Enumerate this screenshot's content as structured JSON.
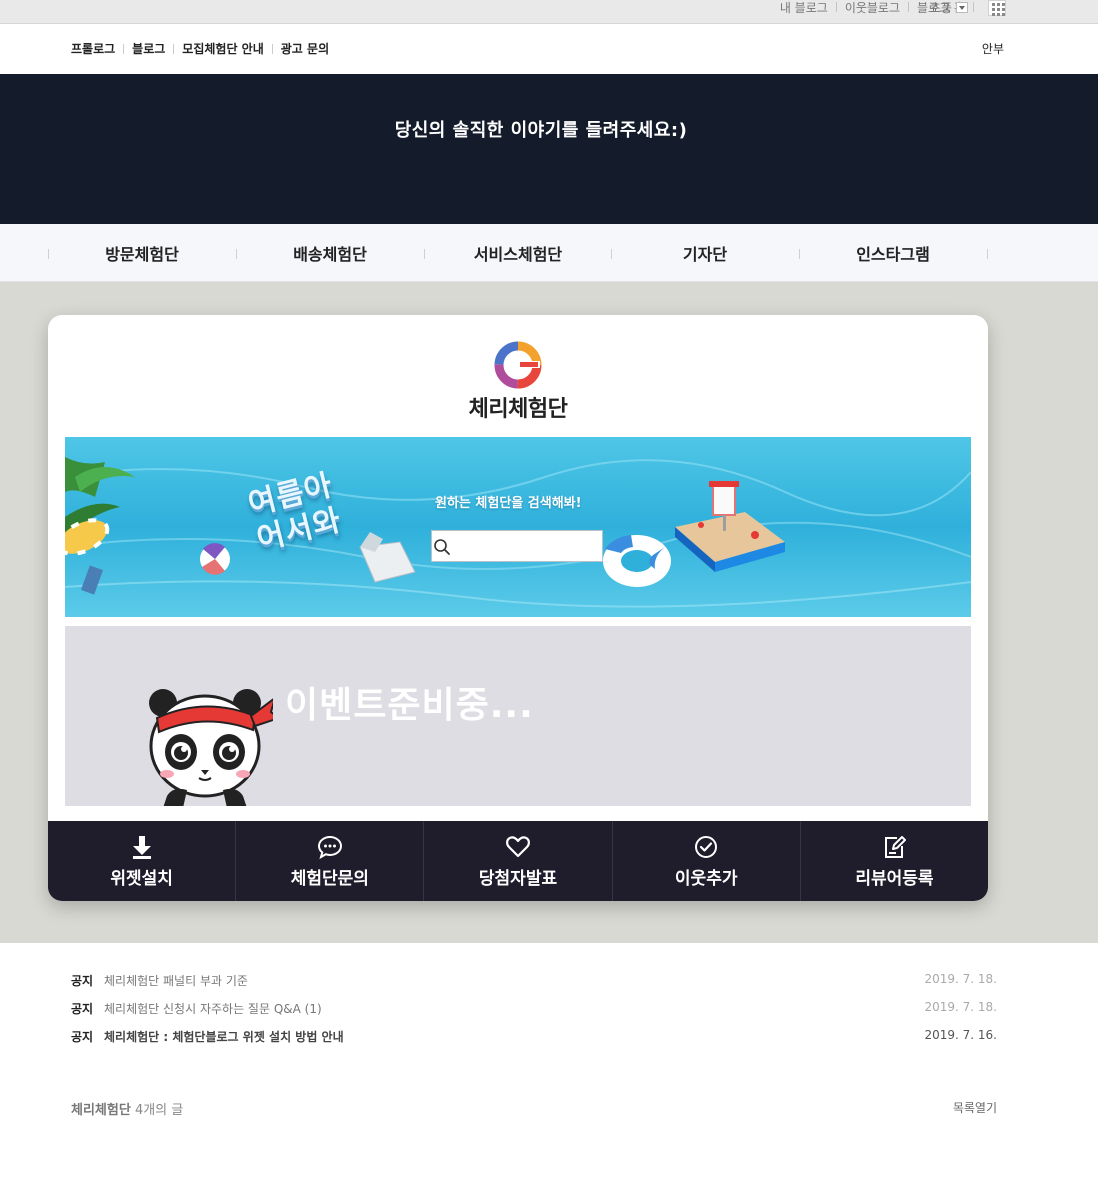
{
  "gnb": {
    "links": [
      "내 블로그",
      "이웃블로그",
      "블로그 홈"
    ],
    "font_label": "초풍"
  },
  "blog_menu": {
    "left_items": [
      "프롤로그",
      "블로그",
      "모집체험단 안내",
      "광고 문의"
    ],
    "right_item": "안부"
  },
  "header": {
    "title": "당신의 솔직한 이야기를 들려주세요:)",
    "bg_color": "#141b2b"
  },
  "categories": [
    "방문체험단",
    "배송체험단",
    "서비스체험단",
    "기자단",
    "인스타그램"
  ],
  "card": {
    "logo_text": "체리체험단",
    "pool_banner": {
      "art_text_line1": "여름아",
      "art_text_line2": "어서와",
      "search_label": "원하는 체험단을 검색해봐!",
      "search_placeholder": ""
    },
    "event_banner": {
      "text": "이벤트준비중..."
    },
    "buttons": [
      {
        "label": "위젯설치",
        "icon": "download-icon"
      },
      {
        "label": "체험단문의",
        "icon": "chat-bubble-icon"
      },
      {
        "label": "당첨자발표",
        "icon": "heart-icon"
      },
      {
        "label": "이웃추가",
        "icon": "check-circle-icon"
      },
      {
        "label": "리뷰어등록",
        "icon": "edit-icon"
      }
    ]
  },
  "notices": [
    {
      "tag": "공지",
      "title": "체리체험단 패널티 부과 기준",
      "date": "2019. 7. 18."
    },
    {
      "tag": "공지",
      "title": "체리체험단 신청시 자주하는 질문 Q&A (1)",
      "date": "2019. 7. 18."
    },
    {
      "tag": "공지",
      "title": "체리체험단 : 체험단블로그 위젯 설치 방법 안내",
      "date": "2019. 7. 16."
    }
  ],
  "post_list": {
    "category": "체리체험단",
    "count_text": "4개의 글",
    "open_label": "목록열기"
  }
}
